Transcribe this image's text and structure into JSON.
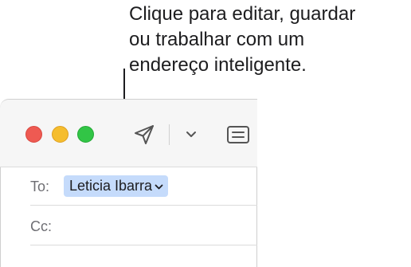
{
  "callout": {
    "line1": "Clique para editar, guardar",
    "line2": "ou trabalhar com um",
    "line3": "endereço inteligente."
  },
  "window": {
    "toolbar": {
      "icons": [
        "close-light",
        "minimize-light",
        "zoom-light",
        "send-icon",
        "chevron-down-icon",
        "header-fields-icon"
      ]
    },
    "fields": {
      "to_label": "To:",
      "to_recipient": "Leticia Ibarra",
      "cc_label": "Cc:"
    }
  },
  "colors": {
    "close": "#ee5a52",
    "minimize": "#f5bd2e",
    "zoom": "#32c546",
    "token_bg": "#c5dbfb"
  }
}
